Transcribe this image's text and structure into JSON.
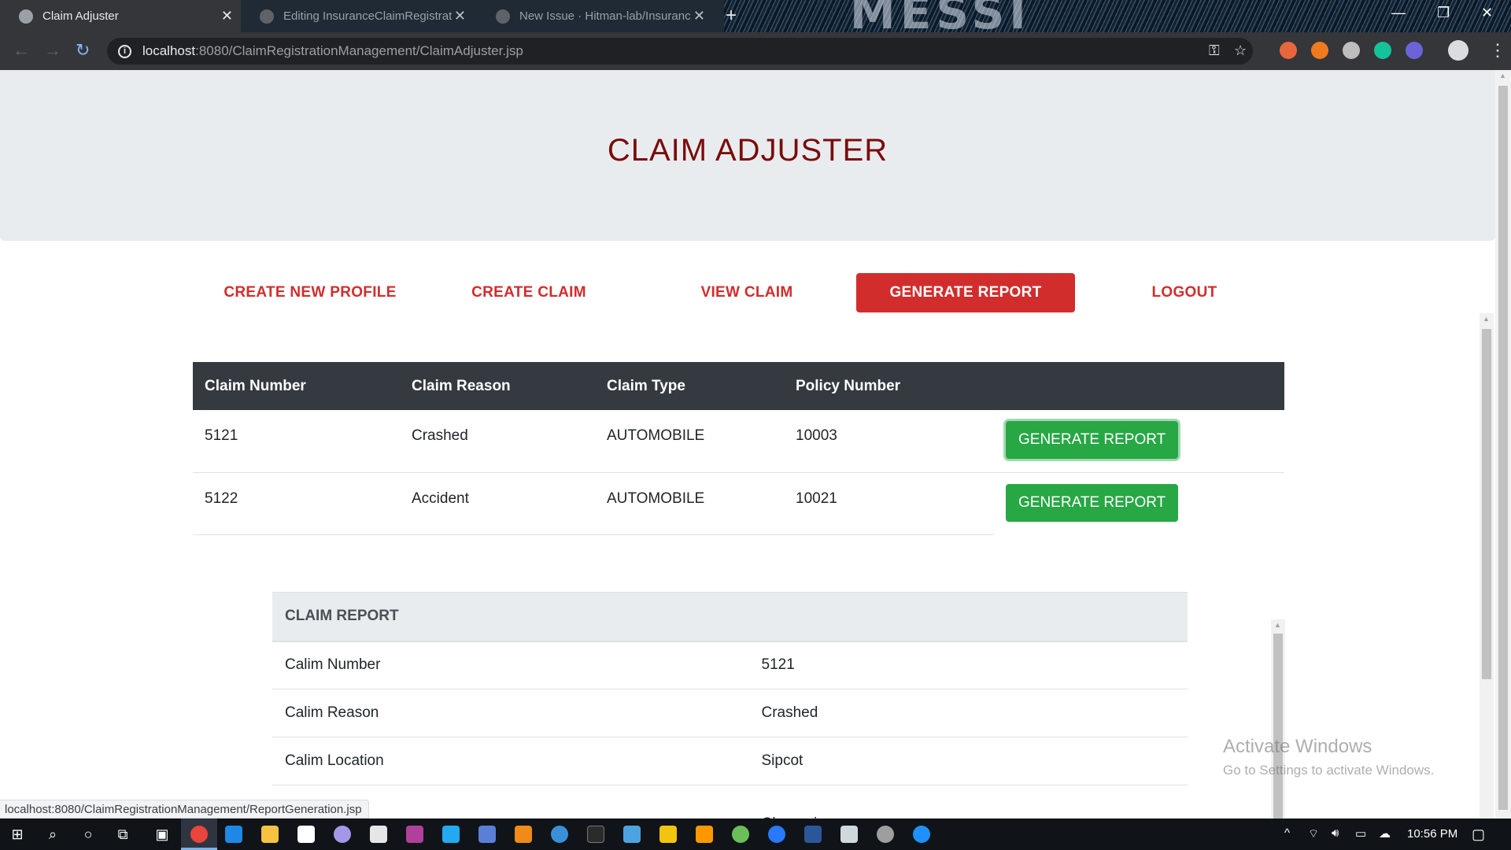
{
  "browser": {
    "tabs": [
      {
        "title": "Claim Adjuster",
        "active": true
      },
      {
        "title": "Editing InsuranceClaimRegistrat",
        "active": false
      },
      {
        "title": "New Issue · Hitman-lab/Insuranc",
        "active": false
      }
    ],
    "window_background_text": "MESSI",
    "url_host": "localhost",
    "url_path": ":8080/ClaimRegistrationManagement/ClaimAdjuster.jsp",
    "status_url": "localhost:8080/ClaimRegistrationManagement/ReportGeneration.jsp"
  },
  "page": {
    "title": "CLAIM ADJUSTER",
    "nav": [
      {
        "label": "CREATE NEW PROFILE",
        "active": false
      },
      {
        "label": "CREATE CLAIM",
        "active": false
      },
      {
        "label": "VIEW CLAIM",
        "active": false
      },
      {
        "label": "GENERATE REPORT",
        "active": true
      },
      {
        "label": "LOGOUT",
        "active": false
      }
    ],
    "claims_table": {
      "headers": [
        "Claim Number",
        "Claim Reason",
        "Claim Type",
        "Policy Number"
      ],
      "rows": [
        {
          "claim_number": "5121",
          "claim_reason": "Crashed",
          "claim_type": "AUTOMOBILE",
          "policy_number": "10003",
          "button": "GENERATE REPORT"
        },
        {
          "claim_number": "5122",
          "claim_reason": "Accident",
          "claim_type": "AUTOMOBILE",
          "policy_number": "10021",
          "button": "GENERATE REPORT"
        }
      ]
    },
    "report": {
      "heading": "CLAIM REPORT",
      "rows": [
        {
          "label": "Calim Number",
          "value": "5121"
        },
        {
          "label": "Calim Reason",
          "value": "Crashed"
        },
        {
          "label": "Calim Location",
          "value": "Sipcot"
        },
        {
          "label": "",
          "value": "Chennai"
        }
      ]
    },
    "watermark": {
      "line1": "Activate Windows",
      "line2": "Go to Settings to activate Windows."
    }
  },
  "taskbar": {
    "time": "10:56 PM"
  },
  "colors": {
    "title": "#7a0c0c",
    "nav_link": "#d12d2d",
    "table_header": "#343a40",
    "success": "#28a745",
    "jumbotron": "#e9ecef"
  }
}
